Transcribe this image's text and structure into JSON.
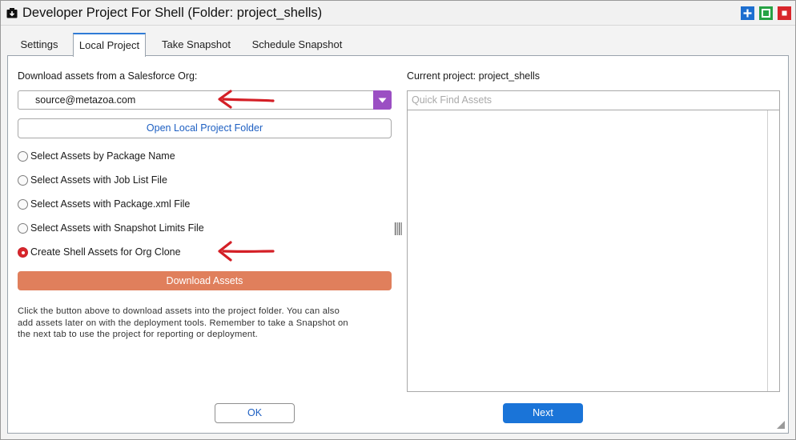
{
  "window": {
    "title": "Developer Project For Shell (Folder: project_shells)",
    "icon": "download-box-icon",
    "controls": [
      {
        "name": "add-window-button",
        "icon": "plus-icon",
        "color": "#1d6fd0"
      },
      {
        "name": "maximize-button",
        "icon": "maximize-icon",
        "color": "#27a244"
      },
      {
        "name": "close-button",
        "icon": "close-icon",
        "color": "#d8262b"
      }
    ]
  },
  "tabs": [
    {
      "label": "Settings",
      "active": false
    },
    {
      "label": "Local Project",
      "active": true
    },
    {
      "label": "Take Snapshot",
      "active": false
    },
    {
      "label": "Schedule Snapshot",
      "active": false
    }
  ],
  "left": {
    "download_label": "Download assets from a Salesforce Org:",
    "org_select": {
      "value": "source@metazoa.com",
      "button_color": "#9b4fc3",
      "icon": "chevron-down-icon"
    },
    "open_folder_label": "Open Local Project Folder",
    "options": [
      {
        "label": "Select Assets by Package Name",
        "checked": false
      },
      {
        "label": "Select Assets with Job List File",
        "checked": false
      },
      {
        "label": "Select Assets with Package.xml File",
        "checked": false
      },
      {
        "label": "Select Assets with Snapshot Limits File",
        "checked": false
      },
      {
        "label": "Create Shell Assets for Org Clone",
        "checked": true
      }
    ],
    "download_button_label": "Download Assets",
    "download_button_color": "#e07f5c",
    "help_lines": [
      "Click the button above to download assets into the project folder. You can also",
      "add assets later on with the deployment tools. Remember to take a Snapshot on",
      "the next tab to use the project for reporting or deployment."
    ]
  },
  "right": {
    "current_project_label": "Current project: project_shells",
    "quick_find_placeholder": "Quick Find Assets"
  },
  "footer": {
    "ok_label": "OK",
    "next_label": "Next",
    "next_color": "#1a74d8"
  },
  "annotations": {
    "arrow_color": "#d41f26",
    "arrows": [
      "arrow-pointing-at-org-select",
      "arrow-pointing-at-shell-option"
    ]
  }
}
